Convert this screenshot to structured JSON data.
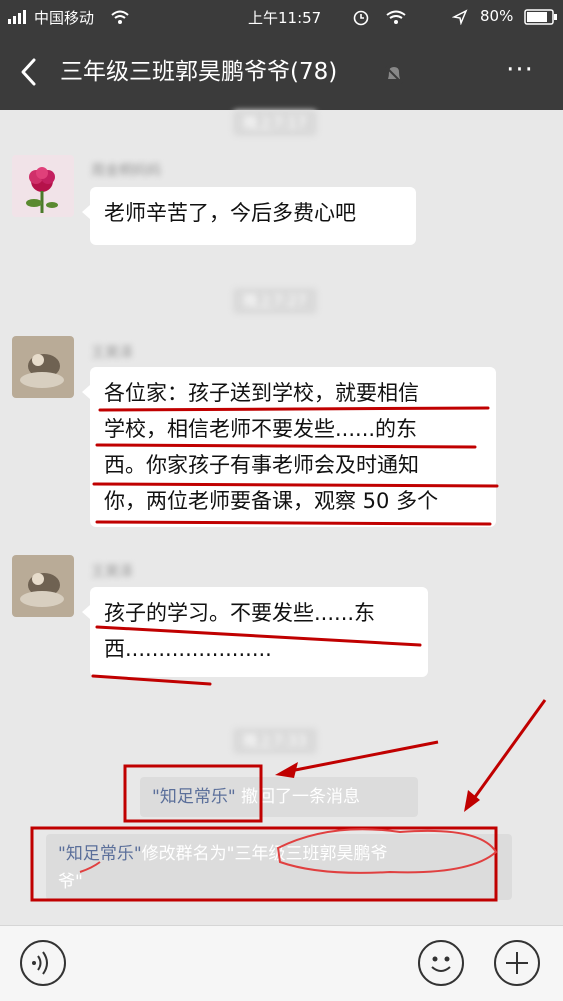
{
  "status_bar": {
    "carrier": "中国移动",
    "time": "上午11:57",
    "battery": "80%",
    "icons": [
      "signal-icon",
      "wifi-icon",
      "alarm-icon",
      "location-icon",
      "battery-icon"
    ]
  },
  "nav": {
    "title": "三年级三班郭昊鹏爷爷(78)",
    "back_icon": "chevron-left-icon",
    "more_label": "···"
  },
  "messages": [
    {
      "type": "time",
      "text": "晚上7:17"
    },
    {
      "type": "text",
      "sender": "周金桐妈妈",
      "avatar": "flower-avatar",
      "text": "老师辛苦了，今后多费心吧"
    },
    {
      "type": "time",
      "text": "晚上7:27"
    },
    {
      "type": "text",
      "sender": "王昊泽",
      "avatar": "photo-avatar",
      "lines": [
        "各位家：孩子送到学校，就要相信",
        "学校，相信老师不要发些......的东",
        "西。你家孩子有事老师会及时通知",
        "你，两位老师要备课，观察 50 多个"
      ]
    },
    {
      "type": "text",
      "sender": "王昊泽",
      "avatar": "photo-avatar",
      "lines": [
        "孩子的学习。不要发些......东",
        "西......................"
      ]
    },
    {
      "type": "time",
      "text": "晚上7:33"
    },
    {
      "type": "system",
      "nick": "\"知足常乐\"",
      "text": " 撤回了一条消息"
    },
    {
      "type": "system",
      "nick": "\"知足常乐\"",
      "text": "修改群名为",
      "new_name": "\"三年级三班郭昊鹏爷爷\"",
      "line1": "三年级三班郭昊鹏爷",
      "line2": "爷\""
    }
  ],
  "input_bar": {
    "icons": [
      "voice-icon",
      "emoji-icon",
      "plus-icon"
    ]
  },
  "colors": {
    "nav_background": "#3b3b3b",
    "chat_background": "#e8e8e8",
    "annotation_red": "#c00000"
  }
}
